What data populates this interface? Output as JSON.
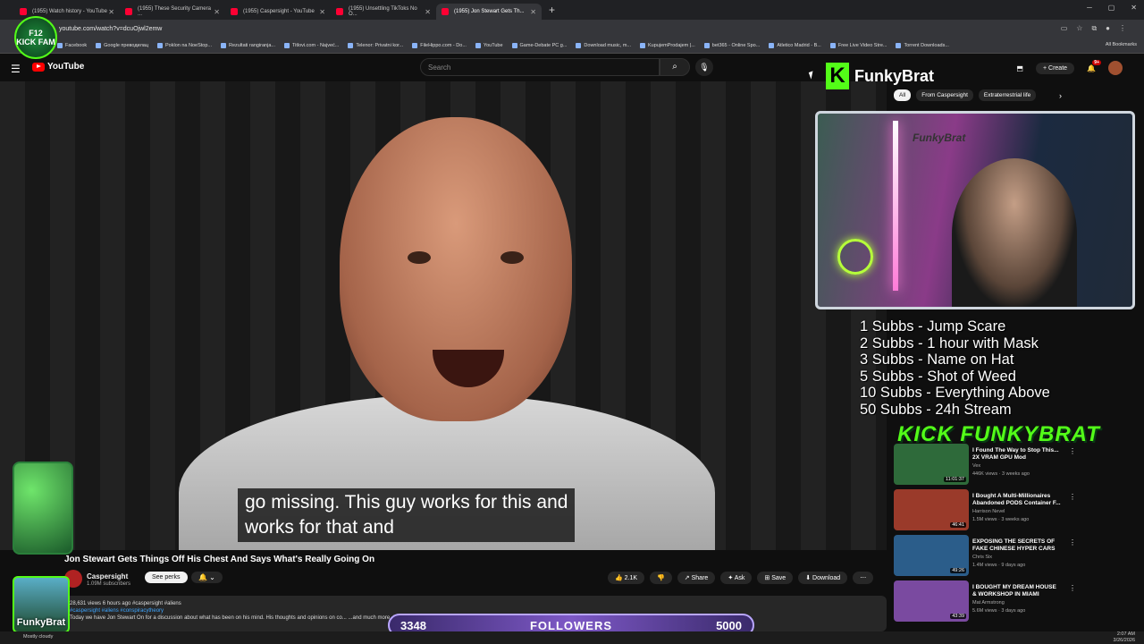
{
  "browser": {
    "tabs": [
      {
        "label": "(1955) Watch history - YouTube",
        "active": false
      },
      {
        "label": "(1955) These Security Camera ...",
        "active": false
      },
      {
        "label": "(1955) Caspersight - YouTube",
        "active": false
      },
      {
        "label": "(1955) Unsettling TikToks No O...",
        "active": false
      },
      {
        "label": "(1955) Jon Stewart Gets Th...",
        "active": true
      }
    ],
    "url": "youtube.com/watch?v=dcuOjwl2emw",
    "bookmarks": [
      "Facebook",
      "Google преводилац",
      "Poklon na NoeStop...",
      "Rezultati rangiranja...",
      "Titlovi.com - Najveć...",
      "Telenor: Privatni kor...",
      "FileHippo.com - Do...",
      "YouTube",
      "Game-Debate PC g...",
      "Download music, m...",
      "KupujemProdajem |...",
      "bet365 - Online Spo...",
      "Atletico Madrid - B...",
      "Free Live Video Stre...",
      "Torrent Downloads..."
    ],
    "all_bookmarks": "All Bookmarks"
  },
  "overlay": {
    "kick_logo_line1": "F12",
    "kick_logo_line2": "KICK FAM",
    "streamer_brand": "FunkyBrat",
    "streamer_name": "FunkyBrat",
    "rewards": [
      "1 Subbs - Jump Scare",
      "2 Subbs - 1 hour with Mask",
      "3 Subbs - Name on Hat",
      "5 Subbs - Shot of Weed",
      "10 Subbs - Everything Above",
      "50 Subbs - 24h Stream"
    ],
    "kick_banner": "KICK FUNKYBRAT",
    "followers_current": "3348",
    "followers_label": "FOLLOWERS",
    "followers_goal": "5000",
    "cam_brand": "FunkyBrat"
  },
  "youtube": {
    "logo": "YouTube",
    "search_placeholder": "Search",
    "create_label": "Create",
    "notif_count": "9+",
    "chips": [
      "All",
      "From Caspersight",
      "Extraterrestrial life"
    ],
    "caption_line1": "go missing. This guy works for this and",
    "caption_line2": "works for that and",
    "video_title": "Jon Stewart Gets Things Off His Chest And Says What's Really Going On",
    "channel_name": "Caspersight",
    "channel_subs": "1.09M subscribers",
    "see_perks": "See perks",
    "likes": "2.1K",
    "share": "Share",
    "ask": "Ask",
    "save": "Save",
    "download": "Download",
    "desc_meta": "28,631 views  6 hours ago  #caspersight #aliens",
    "desc_tags": "#caspersight #aliens #conspiracytheory",
    "desc_text": "Today we have Jon Stewart On for a discussion about what has been on his mind. His thoughts and opinions on co...   ...and much more. Sit back and relax..."
  },
  "sidebar_videos": [
    {
      "title": "I Found The Way to Stop This... 2X VRAM GPU Mod",
      "channel": "Vex",
      "meta": "446K views · 3 weeks ago",
      "duration": "11:01:37",
      "color": "#2e6a3a"
    },
    {
      "title": "I Bought A Multi-Millionaires Abandoned PODS Container F...",
      "channel": "Harrison Nevel",
      "meta": "1.5M views · 3 weeks ago",
      "duration": "46:41",
      "color": "#9a3a2a"
    },
    {
      "title": "EXPOSING THE SECRETS OF FAKE CHINESE HYPER CARS",
      "channel": "Chris Six",
      "meta": "1.4M views · 9 days ago",
      "duration": "49:26",
      "color": "#2b5d8a"
    },
    {
      "title": "I BOUGHT MY DREAM HOUSE & WORKSHOP IN MIAMI",
      "channel": "Mat Armstrong",
      "meta": "5.6M views · 3 days ago",
      "duration": "43:39",
      "color": "#7a4aa0"
    }
  ],
  "taskbar": {
    "weather": "Mostly cloudy",
    "time": "2:07 AM",
    "date": "3/26/2026"
  }
}
